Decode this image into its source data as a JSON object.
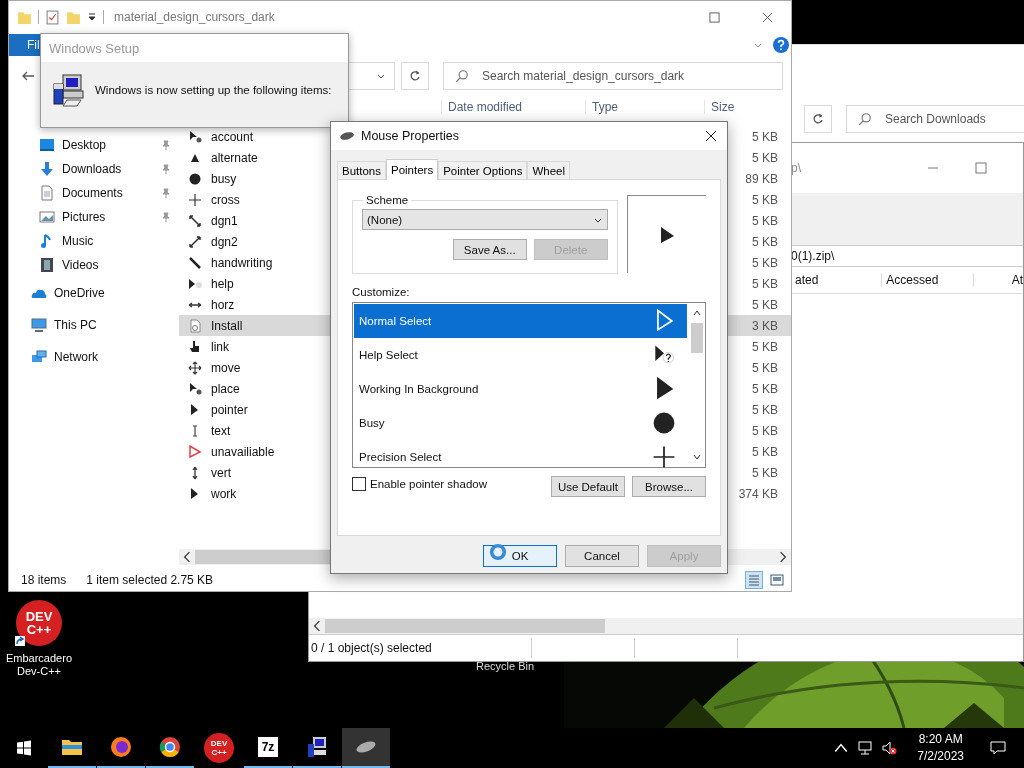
{
  "desktop": {
    "shortcut": {
      "logo_text": [
        "DEV",
        "C++"
      ],
      "label": "Embarcadero Dev-C++"
    },
    "recycle_bin_label": "Recycle Bin"
  },
  "downloads_window": {
    "search": {
      "placeholder": "Search Downloads"
    }
  },
  "archive_window": {
    "title_fragment": "p\\",
    "address": "0(1).zip\\",
    "columns": [
      "ated",
      "Accessed",
      "At"
    ],
    "status": "0 / 1 object(s) selected"
  },
  "explorer": {
    "title": "material_design_cursors_dark",
    "ribbon_tab": "Fil",
    "search": {
      "placeholder": "Search material_design_cursors_dark"
    },
    "columns": [
      "Date modified",
      "Type",
      "Size"
    ],
    "nav": [
      {
        "label": "Desktop",
        "kind": "desktop",
        "pinned": true,
        "indent": true
      },
      {
        "label": "Downloads",
        "kind": "downloads",
        "pinned": true,
        "indent": true
      },
      {
        "label": "Documents",
        "kind": "documents",
        "pinned": true,
        "indent": true
      },
      {
        "label": "Pictures",
        "kind": "pictures",
        "pinned": true,
        "indent": true
      },
      {
        "label": "Music",
        "kind": "music",
        "pinned": false,
        "indent": true
      },
      {
        "label": "Videos",
        "kind": "videos",
        "pinned": false,
        "indent": true
      },
      {
        "label": "OneDrive",
        "kind": "cloud",
        "pinned": false,
        "indent": false
      },
      {
        "label": "This PC",
        "kind": "pc",
        "pinned": false,
        "indent": false
      },
      {
        "label": "Network",
        "kind": "network",
        "pinned": false,
        "indent": false
      }
    ],
    "files": [
      {
        "name": "account",
        "kind": "busyarrow",
        "size": "5 KB",
        "selected": false
      },
      {
        "name": "alternate",
        "kind": "up",
        "size": "5 KB",
        "selected": false
      },
      {
        "name": "busy",
        "kind": "busy",
        "size": "89 KB",
        "selected": false
      },
      {
        "name": "cross",
        "kind": "cross",
        "size": "5 KB",
        "selected": false
      },
      {
        "name": "dgn1",
        "kind": "diag1",
        "size": "5 KB",
        "selected": false
      },
      {
        "name": "dgn2",
        "kind": "diag2",
        "size": "5 KB",
        "selected": false
      },
      {
        "name": "handwriting",
        "kind": "pen",
        "size": "5 KB",
        "selected": false
      },
      {
        "name": "help",
        "kind": "help",
        "size": "5 KB",
        "selected": false
      },
      {
        "name": "horz",
        "kind": "horz",
        "size": "5 KB",
        "selected": false
      },
      {
        "name": "Install",
        "kind": "setup",
        "size": "3 KB",
        "selected": true
      },
      {
        "name": "link",
        "kind": "hand",
        "size": "5 KB",
        "selected": false
      },
      {
        "name": "move",
        "kind": "move",
        "size": "5 KB",
        "selected": false
      },
      {
        "name": "place",
        "kind": "busyarrow",
        "size": "5 KB",
        "selected": false
      },
      {
        "name": "pointer",
        "kind": "arrow",
        "size": "5 KB",
        "selected": false
      },
      {
        "name": "text",
        "kind": "text",
        "size": "5 KB",
        "selected": false
      },
      {
        "name": "unavailiable",
        "kind": "unavailable",
        "size": "5 KB",
        "selected": false
      },
      {
        "name": "vert",
        "kind": "vert",
        "size": "5 KB",
        "selected": false
      },
      {
        "name": "work",
        "kind": "arrow",
        "size": "374 KB",
        "selected": false
      }
    ],
    "status": [
      "18 items",
      "1 item selected  2.75 KB"
    ]
  },
  "setup_dialog": {
    "title": "Windows Setup",
    "message": "Windows is now setting up the following items:"
  },
  "mouse_dialog": {
    "title": "Mouse Properties",
    "tabs": [
      {
        "label": "Buttons",
        "selected": false
      },
      {
        "label": "Pointers",
        "selected": true
      },
      {
        "label": "Pointer Options",
        "selected": false
      },
      {
        "label": "Wheel",
        "selected": false
      }
    ],
    "scheme": {
      "label": "Scheme",
      "value": "(None)"
    },
    "scheme_buttons": [
      {
        "label": "Save As...",
        "disabled": false
      },
      {
        "label": "Delete",
        "disabled": true
      }
    ],
    "customize_label": "Customize:",
    "cursors": [
      {
        "name": "Normal Select",
        "kind": "arrow",
        "selected": true
      },
      {
        "name": "Help Select",
        "kind": "help",
        "selected": false
      },
      {
        "name": "Working In Background",
        "kind": "arrow",
        "selected": false
      },
      {
        "name": "Busy",
        "kind": "busy",
        "selected": false
      },
      {
        "name": "Precision Select",
        "kind": "cross",
        "selected": false
      }
    ],
    "shadow": {
      "label": "Enable pointer shadow",
      "checked": false
    },
    "list_buttons": [
      {
        "label": "Use Default",
        "disabled": false
      },
      {
        "label": "Browse...",
        "disabled": false
      }
    ],
    "footer_buttons": [
      {
        "label": "OK",
        "disabled": false,
        "default": true
      },
      {
        "label": "Cancel",
        "disabled": false,
        "default": false
      },
      {
        "label": "Apply",
        "disabled": true,
        "default": false
      }
    ]
  },
  "taskbar": {
    "apps": [
      {
        "kind": "explorer",
        "running": true,
        "active": false
      },
      {
        "kind": "firefox",
        "running": true,
        "active": false
      },
      {
        "kind": "chrome",
        "running": true,
        "active": false
      },
      {
        "kind": "devcpp",
        "running": false,
        "active": false,
        "glyph": "DEV C++"
      },
      {
        "kind": "sevenzip",
        "running": true,
        "active": false,
        "glyph": "7z"
      },
      {
        "kind": "setup",
        "running": true,
        "active": false
      },
      {
        "kind": "mouse",
        "running": true,
        "active": true
      }
    ],
    "time": "8:20 AM",
    "date": "7/2/2023"
  }
}
